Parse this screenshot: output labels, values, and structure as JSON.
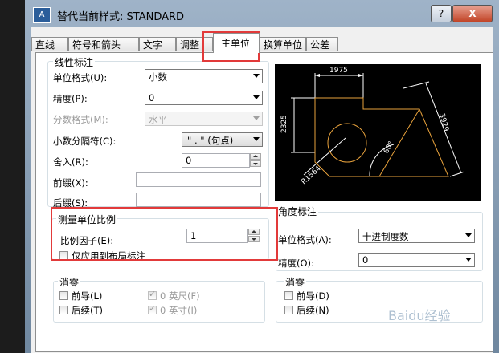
{
  "window": {
    "title": "替代当前样式: STANDARD",
    "help": "?",
    "close": "X",
    "icon_text": "A"
  },
  "tabs": [
    "直线",
    "符号和箭头",
    "文字",
    "调整",
    "主单位",
    "换算单位",
    "公差"
  ],
  "linear": {
    "title": "线性标注",
    "unit_format_label": "单位格式(U):",
    "unit_format_value": "小数",
    "precision_label": "精度(P):",
    "precision_value": "0",
    "fraction_label": "分数格式(M):",
    "fraction_value": "水平",
    "decimal_sep_label": "小数分隔符(C):",
    "decimal_sep_value": "\" . \" (句点)",
    "roundoff_label": "舍入(R):",
    "roundoff_value": "0",
    "prefix_label": "前缀(X):",
    "prefix_value": "",
    "suffix_label": "后缀(S):",
    "suffix_value": ""
  },
  "scale": {
    "title": "测量单位比例",
    "factor_label": "比例因子(E):",
    "factor_value": "1",
    "layout_only_label": "仅应用到布局标注"
  },
  "zero_left": {
    "title": "消零",
    "leading": "前导(L)",
    "trailing": "后续(T)",
    "feet": "0 英尺(F)",
    "inches": "0 英寸(I)"
  },
  "angular": {
    "title": "角度标注",
    "unit_format_label": "单位格式(A):",
    "unit_format_value": "十进制度数",
    "precision_label": "精度(O):",
    "precision_value": "0"
  },
  "zero_right": {
    "title": "消零",
    "leading": "前导(D)",
    "trailing": "后续(N)"
  },
  "preview": {
    "dim_top": "1975",
    "dim_left": "2325",
    "dim_right": "3929",
    "dim_angle": "60°",
    "dim_radius": "R1564"
  },
  "colors": {
    "highlight": "#e23a3a",
    "preview_bg": "#000000",
    "dim_lines": "#ffffff",
    "geometry": "#e8a23c"
  },
  "watermark": "Baidu经验"
}
